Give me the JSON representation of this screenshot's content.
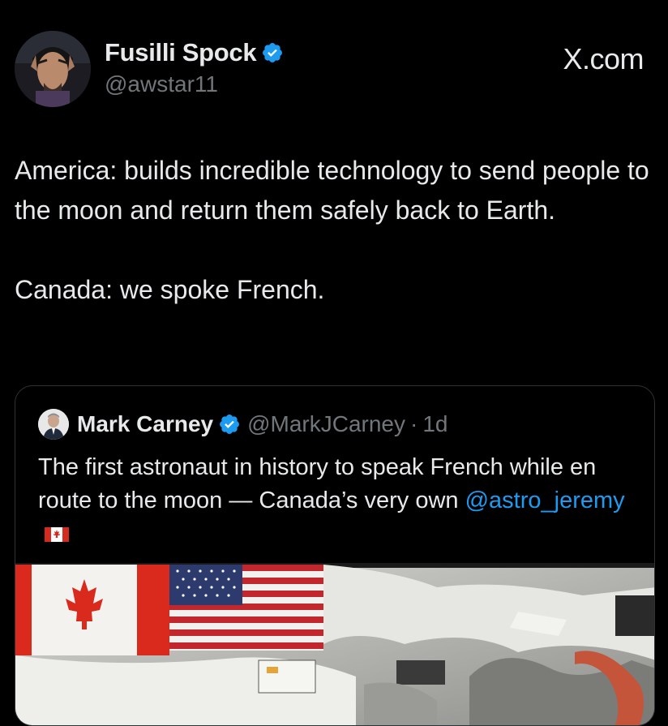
{
  "author": {
    "display_name": "Fusilli Spock",
    "handle": "@awstar11",
    "verified_icon": "verified-badge-icon"
  },
  "site_label": "X.com",
  "tweet": {
    "paragraph_1": "America: builds incredible technology to send people to the moon and return them safely back to Earth.",
    "paragraph_2": "Canada: we spoke French."
  },
  "quoted": {
    "display_name": "Mark Carney",
    "handle": "@MarkJCarney",
    "separator": "·",
    "time": "1d",
    "text": "The first astronaut in history to speak French while en route to the moon — Canada’s very own ",
    "mention": "@astro_jeremy",
    "flag_icon": "canada-flag-icon"
  },
  "colors": {
    "background": "#000000",
    "text": "#e7e9ea",
    "muted": "#71767b",
    "accent": "#1d9bf0",
    "border": "#2f3336"
  }
}
